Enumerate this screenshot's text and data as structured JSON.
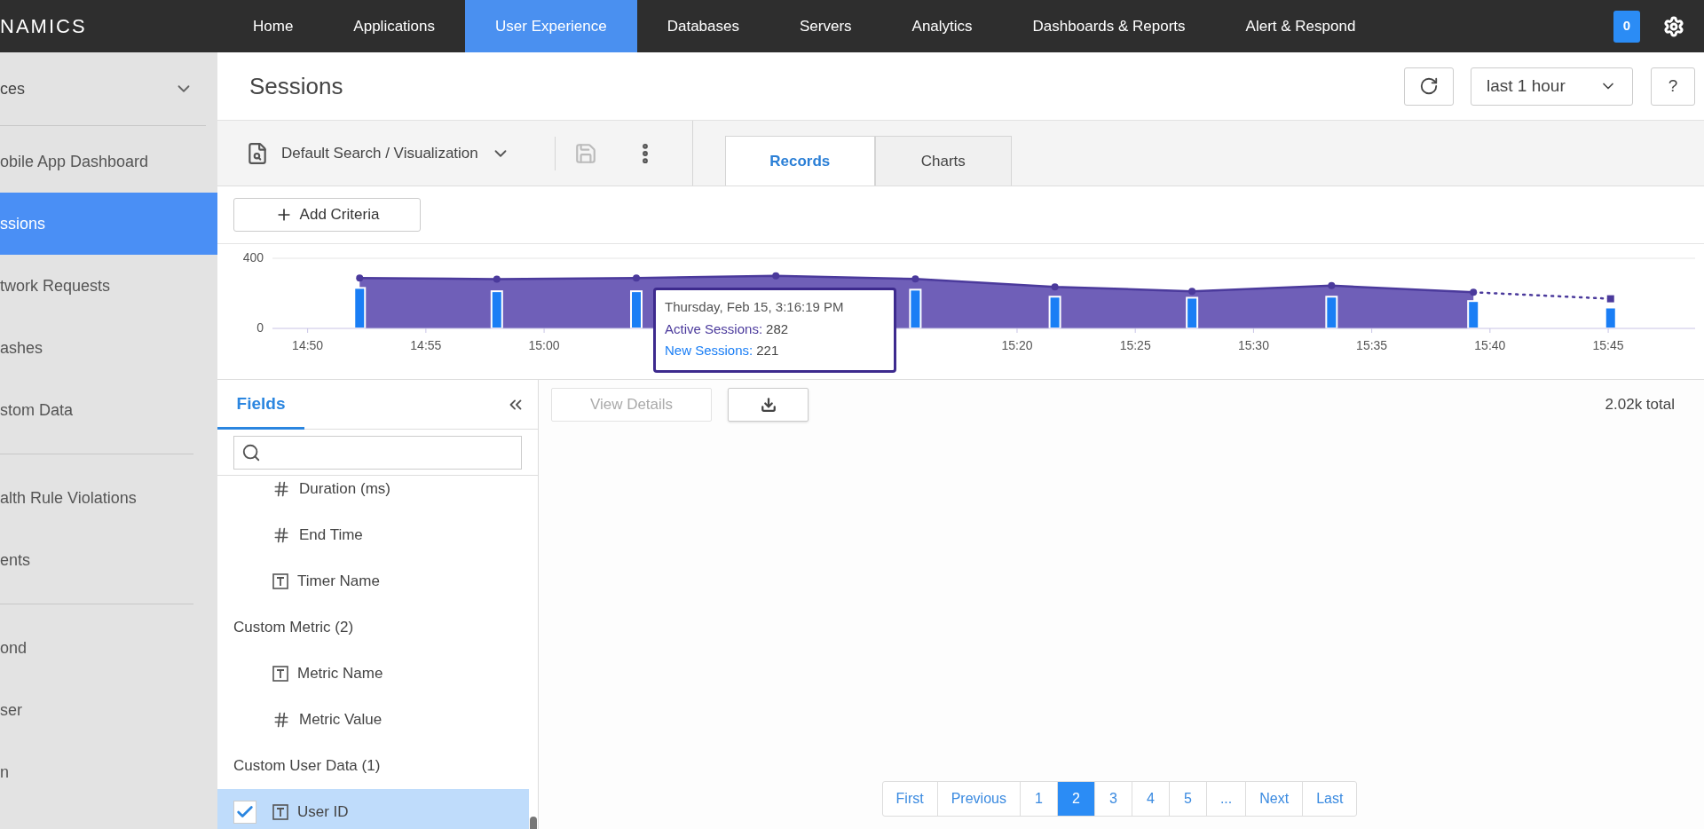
{
  "top_nav": {
    "logo": "NAMICS",
    "items": [
      {
        "label": "Home",
        "selected": false
      },
      {
        "label": "Applications",
        "selected": false
      },
      {
        "label": "User Experience",
        "selected": true
      },
      {
        "label": "Databases",
        "selected": false
      },
      {
        "label": "Servers",
        "selected": false
      },
      {
        "label": "Analytics",
        "selected": false
      },
      {
        "label": "Dashboards & Reports",
        "selected": false
      },
      {
        "label": "Alert & Respond",
        "selected": false
      }
    ],
    "badge": "0"
  },
  "sidebar": {
    "header": "ces",
    "groups": [
      {
        "items": [
          {
            "label": "obile App Dashboard",
            "selected": false
          },
          {
            "label": "ssions",
            "selected": true
          },
          {
            "label": "twork Requests",
            "selected": false
          },
          {
            "label": "ashes",
            "selected": false
          },
          {
            "label": "stom Data",
            "selected": false
          }
        ]
      },
      {
        "items": [
          {
            "label": "alth Rule Violations",
            "selected": false
          },
          {
            "label": "ents",
            "selected": false
          }
        ]
      },
      {
        "items": [
          {
            "label": "ond",
            "selected": false
          },
          {
            "label": "ser",
            "selected": false
          },
          {
            "label": "n",
            "selected": false
          }
        ]
      }
    ]
  },
  "page": {
    "title": "Sessions",
    "time_range": "last 1 hour",
    "help": "?"
  },
  "toolbar": {
    "search_name": "Default Search / Visualization",
    "tabs": [
      {
        "label": "Records",
        "selected": true
      },
      {
        "label": "Charts",
        "selected": false
      }
    ]
  },
  "add_criteria": "Add Criteria",
  "chart": {
    "chart_data": {
      "type": "area",
      "xlim": [
        888.7,
        948.6
      ],
      "ylim": [
        0,
        400
      ],
      "yticks": [
        0,
        400
      ],
      "xticks": [
        {
          "value": 890,
          "label": "14:50"
        },
        {
          "value": 895,
          "label": "14:55"
        },
        {
          "value": 900,
          "label": "15:00"
        },
        {
          "value": 920,
          "label": "15:20"
        },
        {
          "value": 925,
          "label": "15:25"
        },
        {
          "value": 930,
          "label": "15:30"
        },
        {
          "value": 935,
          "label": "15:35"
        },
        {
          "value": 940,
          "label": "15:40"
        },
        {
          "value": 945,
          "label": "15:45"
        }
      ],
      "x": [
        892.2,
        898.0,
        903.9,
        909.8,
        915.7,
        921.6,
        927.4,
        933.3,
        939.3,
        945.1
      ],
      "series": [
        {
          "type": "area",
          "color": "#4b3a9c",
          "values": [
            287,
            281,
            287,
            300,
            282,
            237,
            212,
            244,
            206,
            null
          ]
        },
        {
          "type": "bar",
          "color": "#1a7ef5",
          "values": [
            231,
            212,
            212,
            null,
            221,
            181,
            175,
            181,
            156,
            119
          ]
        },
        {
          "type": "line",
          "line_style": "dotted",
          "color": "#4b3a9c",
          "values": [
            null,
            null,
            null,
            null,
            null,
            null,
            null,
            null,
            206,
            169
          ]
        }
      ]
    },
    "tooltip": {
      "title": "Thursday, Feb 15, 3:16:19 PM",
      "lines": [
        {
          "label": "Active Sessions:",
          "value": "282",
          "color": "#4b3a9c"
        },
        {
          "label": "New Sessions:",
          "value": "221",
          "color": "#1a7ef5"
        }
      ]
    }
  },
  "fields_panel": {
    "tab": "Fields",
    "items": [
      {
        "kind": "number",
        "label": "Duration (ms)",
        "checked": false
      },
      {
        "kind": "number",
        "label": "End Time",
        "checked": false
      },
      {
        "kind": "text",
        "label": "Timer Name",
        "checked": false
      },
      {
        "kind": "group",
        "label": "Custom Metric (2)"
      },
      {
        "kind": "text",
        "label": "Metric Name",
        "checked": false
      },
      {
        "kind": "number",
        "label": "Metric Value",
        "checked": false
      },
      {
        "kind": "group",
        "label": "Custom User Data (1)"
      },
      {
        "kind": "text",
        "label": "User ID",
        "checked": true
      }
    ]
  },
  "results": {
    "view_details": {
      "label": "View Details",
      "disabled": true
    },
    "total": "2.02k total",
    "pagination": [
      {
        "label": "First",
        "selected": false
      },
      {
        "label": "Previous",
        "selected": false
      },
      {
        "label": "1",
        "selected": false
      },
      {
        "label": "2",
        "selected": true
      },
      {
        "label": "3",
        "selected": false
      },
      {
        "label": "4",
        "selected": false
      },
      {
        "label": "5",
        "selected": false
      },
      {
        "label": "...",
        "selected": false
      },
      {
        "label": "Next",
        "selected": false
      },
      {
        "label": "Last",
        "selected": false
      }
    ]
  }
}
